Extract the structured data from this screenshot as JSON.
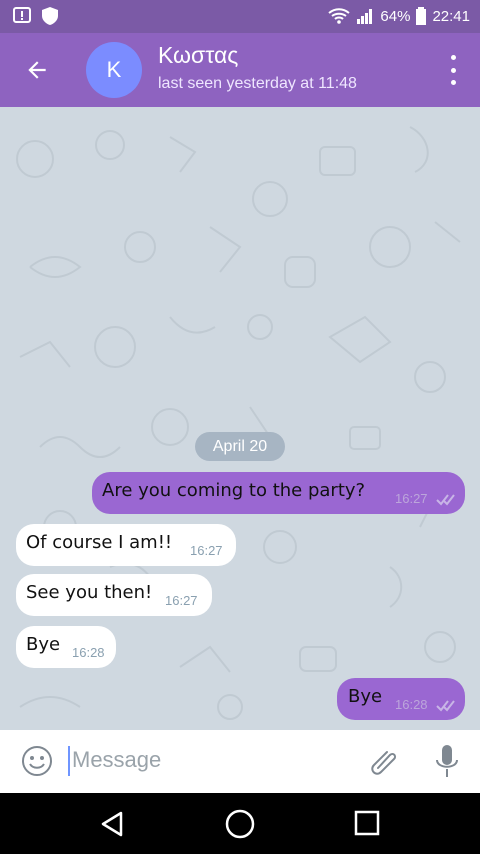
{
  "status_bar": {
    "battery_percent": "64%",
    "time": "22:41"
  },
  "header": {
    "avatar_initial": "K",
    "title": "Κωστας",
    "subtitle": "last seen yesterday at 11:48"
  },
  "chat": {
    "date_chip": "April 20",
    "messages": [
      {
        "text": "Are you coming to the party?",
        "time": "16:27",
        "direction": "outgoing"
      },
      {
        "text": "Of course I am!!",
        "time": "16:27",
        "direction": "incoming"
      },
      {
        "text": "See you then!",
        "time": "16:27",
        "direction": "incoming"
      },
      {
        "text": "Bye",
        "time": "16:28",
        "direction": "incoming"
      },
      {
        "text": "Bye",
        "time": "16:28",
        "direction": "outgoing"
      }
    ]
  },
  "composer": {
    "placeholder": "Message"
  },
  "colors": {
    "status_bar": "#7b5aa6",
    "app_bar": "#8e63c0",
    "outgoing_bubble": "#9a67d2",
    "incoming_bubble": "#ffffff",
    "avatar": "#7b8cff",
    "chat_background": "#cfd8e0"
  },
  "icons": {
    "status_left": [
      "notification-alert-icon",
      "shield-icon"
    ],
    "status_right": [
      "wifi-icon",
      "signal-icon",
      "battery-icon"
    ],
    "header_left": "back-arrow-icon",
    "header_right": "more-vert-icon",
    "composer_left": "emoji-icon",
    "composer_right": [
      "attachment-icon",
      "microphone-icon"
    ],
    "nav": [
      "nav-back-icon",
      "nav-home-icon",
      "nav-recents-icon"
    ]
  }
}
